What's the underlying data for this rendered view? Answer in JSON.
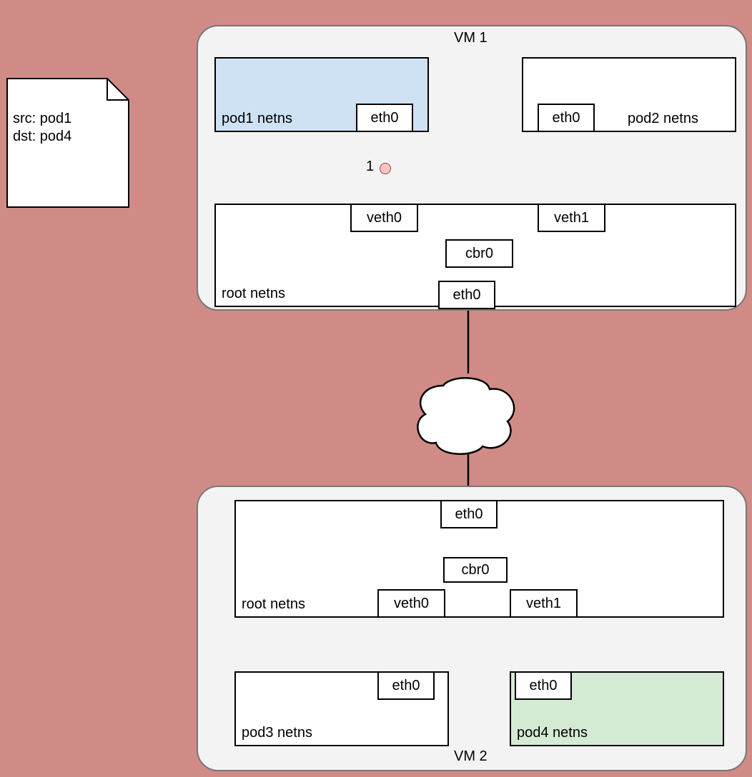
{
  "note": {
    "line1": "src: pod1",
    "line2": "dst: pod4"
  },
  "vm1": {
    "title": "VM 1",
    "pod1": {
      "label": "pod1 netns",
      "iface": "eth0"
    },
    "pod2": {
      "label": "pod2 netns",
      "iface": "eth0"
    },
    "root": {
      "label": "root netns",
      "veth0": "veth0",
      "veth1": "veth1",
      "cbr0": "cbr0",
      "eth0": "eth0"
    },
    "marker": "1"
  },
  "vm2": {
    "title": "VM 2",
    "pod3": {
      "label": "pod3 netns",
      "iface": "eth0"
    },
    "pod4": {
      "label": "pod4 netns",
      "iface": "eth0"
    },
    "root": {
      "label": "root netns",
      "veth0": "veth0",
      "veth1": "veth1",
      "cbr0": "cbr0",
      "eth0": "eth0"
    }
  }
}
